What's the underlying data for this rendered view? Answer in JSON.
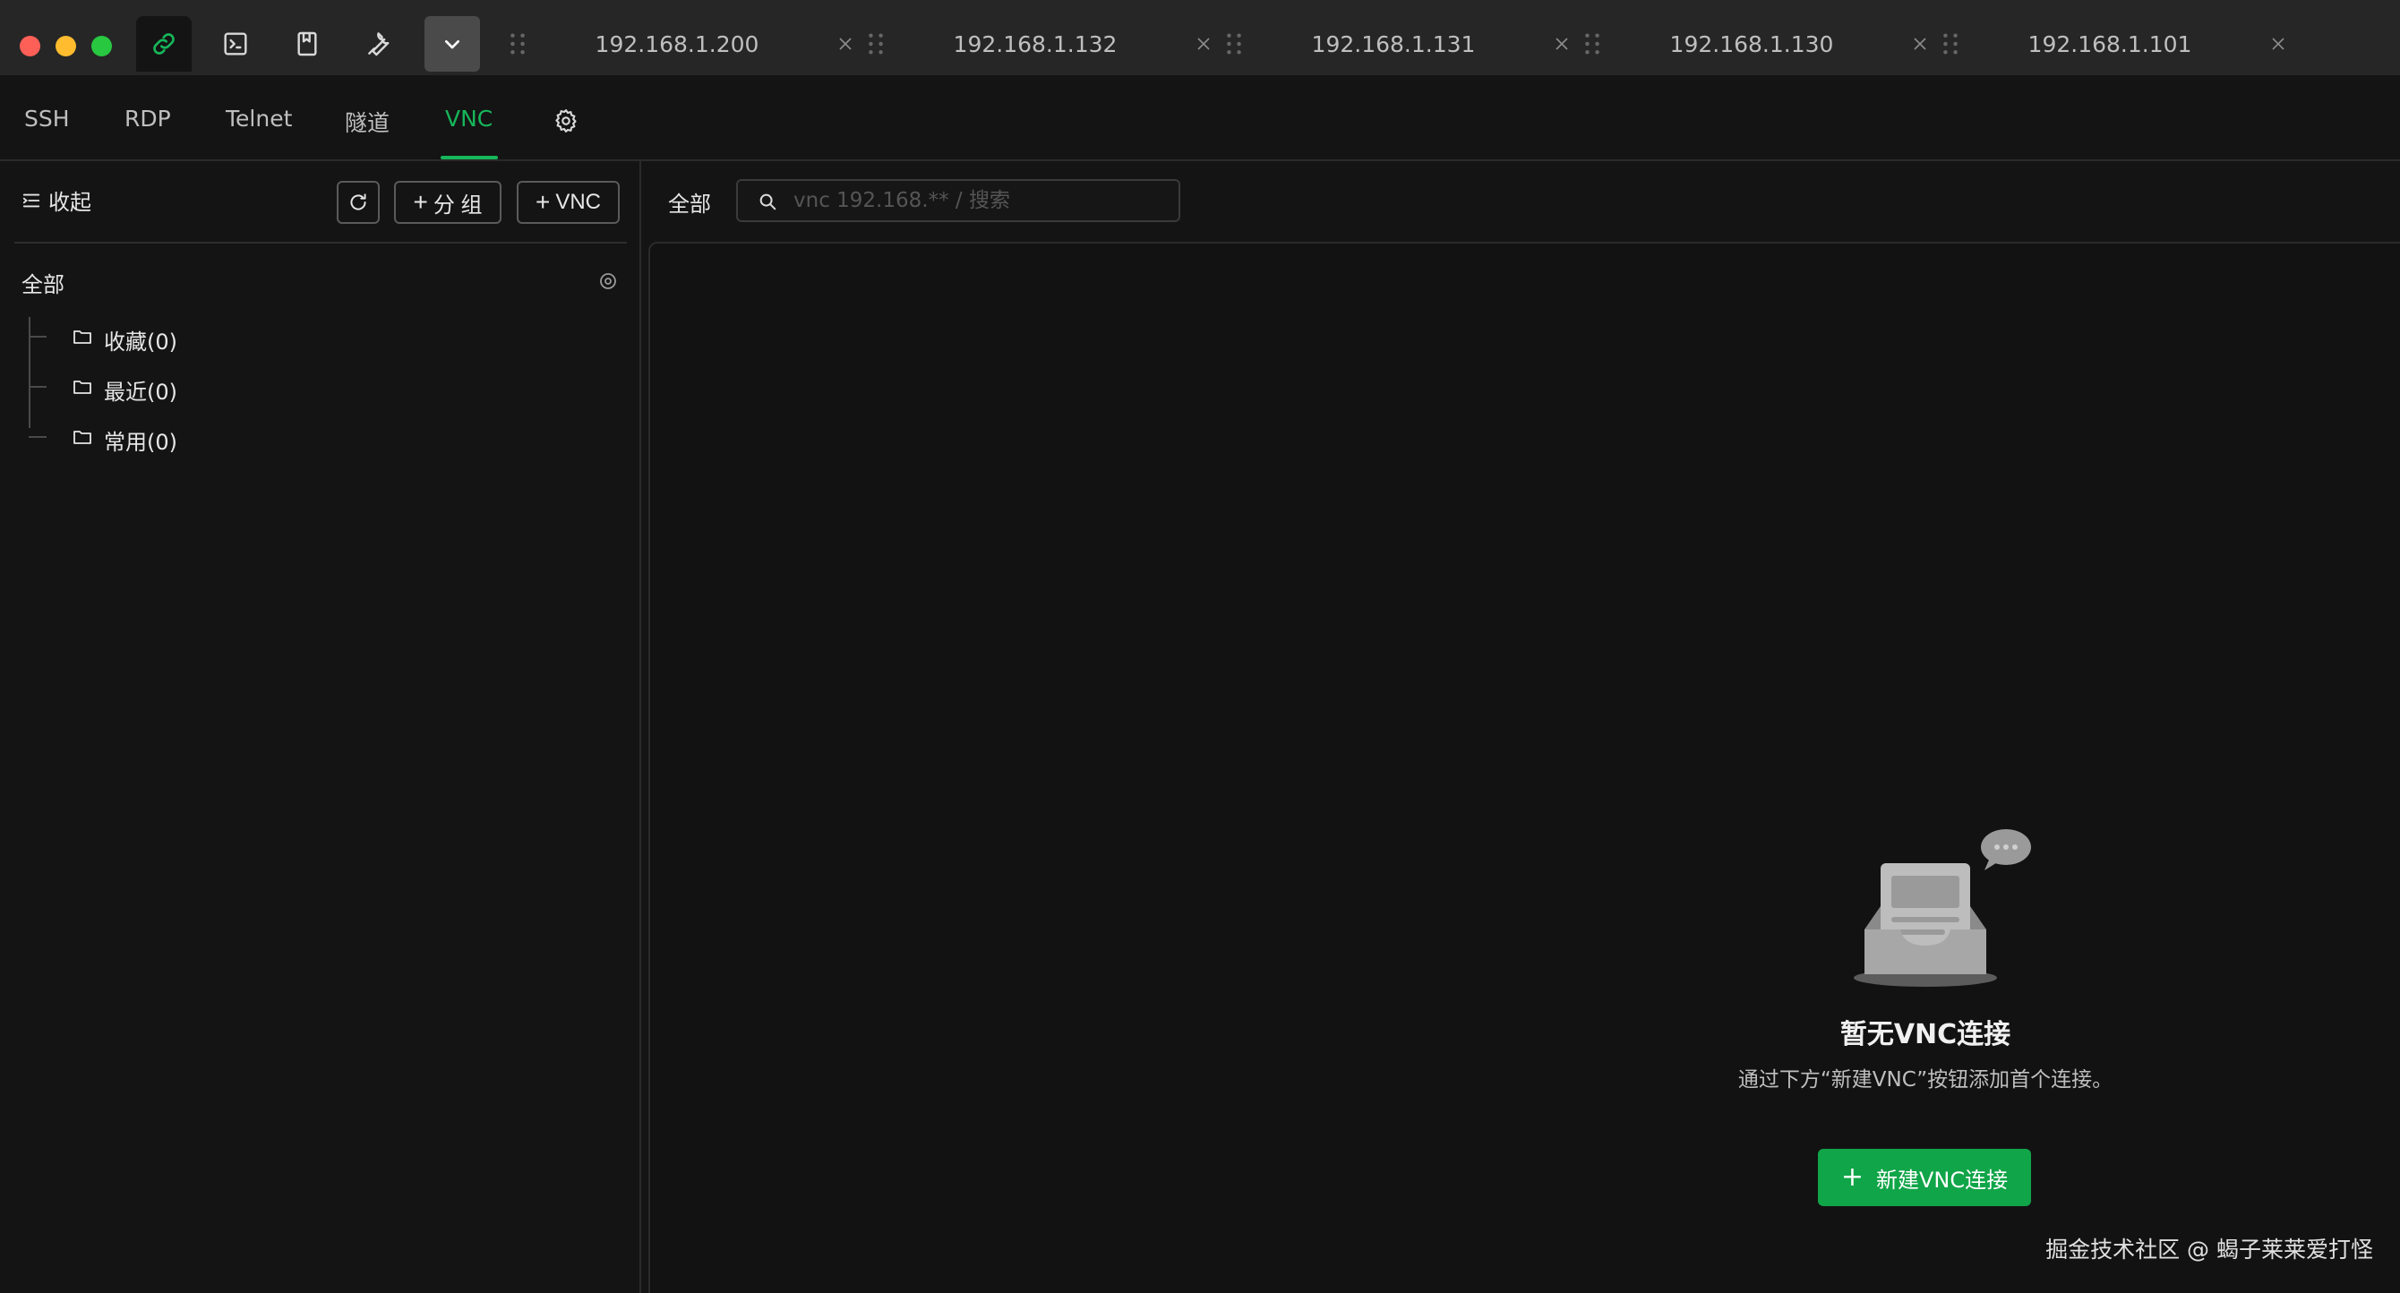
{
  "window": {
    "tools": [
      {
        "name": "connection-icon"
      },
      {
        "name": "terminal-icon"
      },
      {
        "name": "bookmark-icon"
      },
      {
        "name": "wrench-icon"
      },
      {
        "name": "chevron-down-icon"
      }
    ],
    "tabs": [
      {
        "label": "192.168.1.200"
      },
      {
        "label": "192.168.1.132"
      },
      {
        "label": "192.168.1.131"
      },
      {
        "label": "192.168.1.130"
      },
      {
        "label": "192.168.1.101"
      }
    ]
  },
  "protocol_nav": {
    "items": [
      {
        "label": "SSH"
      },
      {
        "label": "RDP"
      },
      {
        "label": "Telnet"
      },
      {
        "label": "隧道"
      },
      {
        "label": "VNC"
      }
    ],
    "active": "VNC",
    "accent_color": "#16b65a"
  },
  "sidebar": {
    "collapse_label": "收起",
    "add_group_label": "分 组",
    "add_vnc_label": "VNC",
    "tree_root": "全部",
    "groups": [
      {
        "label": "收藏(0)"
      },
      {
        "label": "最近(0)"
      },
      {
        "label": "常用(0)"
      }
    ]
  },
  "main": {
    "filter_label": "全部",
    "search": {
      "placeholder": "vnc 192.168.** / 搜索",
      "value": ""
    },
    "empty": {
      "title": "暂无VNC连接",
      "description": "通过下方“新建VNC”按钮添加首个连接。",
      "button_label": "新建VNC连接"
    }
  },
  "watermark": "掘金技术社区 @ 蝎子莱莱爱打怪",
  "colors": {
    "primary_button": "#10a548",
    "background": "#141414",
    "titlebar": "#262626"
  }
}
